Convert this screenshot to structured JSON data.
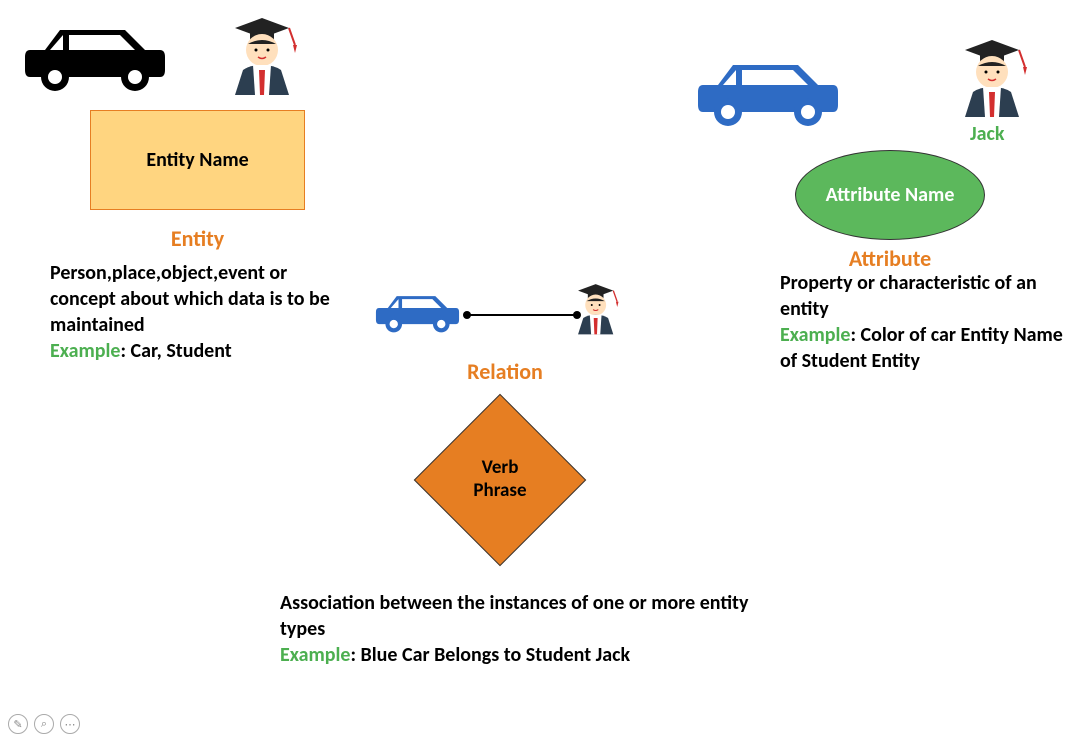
{
  "entity": {
    "box_label": "Entity Name",
    "title": "Entity",
    "desc": "Person,place,object,event or concept about which data is to be maintained",
    "example_label": "Example",
    "example_text": ": Car, Student"
  },
  "relation": {
    "title": "Relation",
    "diamond_label": "Verb Phrase",
    "desc": "Association between the instances of one or more entity types",
    "example_label": "Example",
    "example_text": ": Blue Car Belongs to Student Jack"
  },
  "attribute": {
    "jack": "Jack",
    "ellipse_label": "Attribute Name",
    "title": "Attribute",
    "desc": "Property or characteristic of an entity",
    "example_label": "Example",
    "example_text": ": Color of car Entity Name of Student Entity"
  }
}
